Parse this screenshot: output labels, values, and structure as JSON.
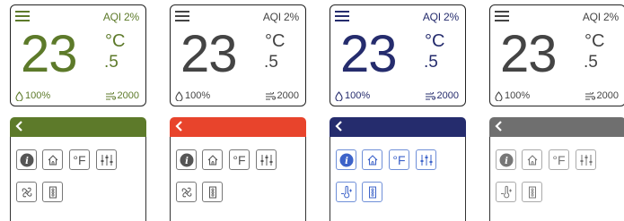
{
  "themes": [
    {
      "name": "green",
      "accent": "#5d7a2a",
      "card_text": "#5d7a2a",
      "aqi": "AQI 2%",
      "temperature": "23",
      "unit": "°C",
      "decimal": ".5",
      "humidity": "100%",
      "fan_speed": "2000",
      "fahrenheit": "°F",
      "second_row_icon": "fan-icon"
    },
    {
      "name": "red",
      "accent": "#e8442c",
      "card_text": "#444444",
      "aqi": "AQI 2%",
      "temperature": "23",
      "unit": "°C",
      "decimal": ".5",
      "humidity": "100%",
      "fan_speed": "2000",
      "fahrenheit": "°F",
      "second_row_icon": "fan-icon"
    },
    {
      "name": "navy",
      "accent": "#252c6d",
      "card_text": "#252c6d",
      "aqi": "AQI 2%",
      "temperature": "23",
      "unit": "°C",
      "decimal": ".5",
      "humidity": "100%",
      "fan_speed": "2000",
      "fahrenheit": "°F",
      "second_row_icon": "thermometer-icon"
    },
    {
      "name": "gray",
      "accent": "#6f6f6f",
      "card_text": "#444444",
      "aqi": "AQI 2%",
      "temperature": "23",
      "unit": "°C",
      "decimal": ".5",
      "humidity": "100%",
      "fan_speed": "2000",
      "fahrenheit": "°F",
      "second_row_icon": "thermometer-icon"
    }
  ]
}
